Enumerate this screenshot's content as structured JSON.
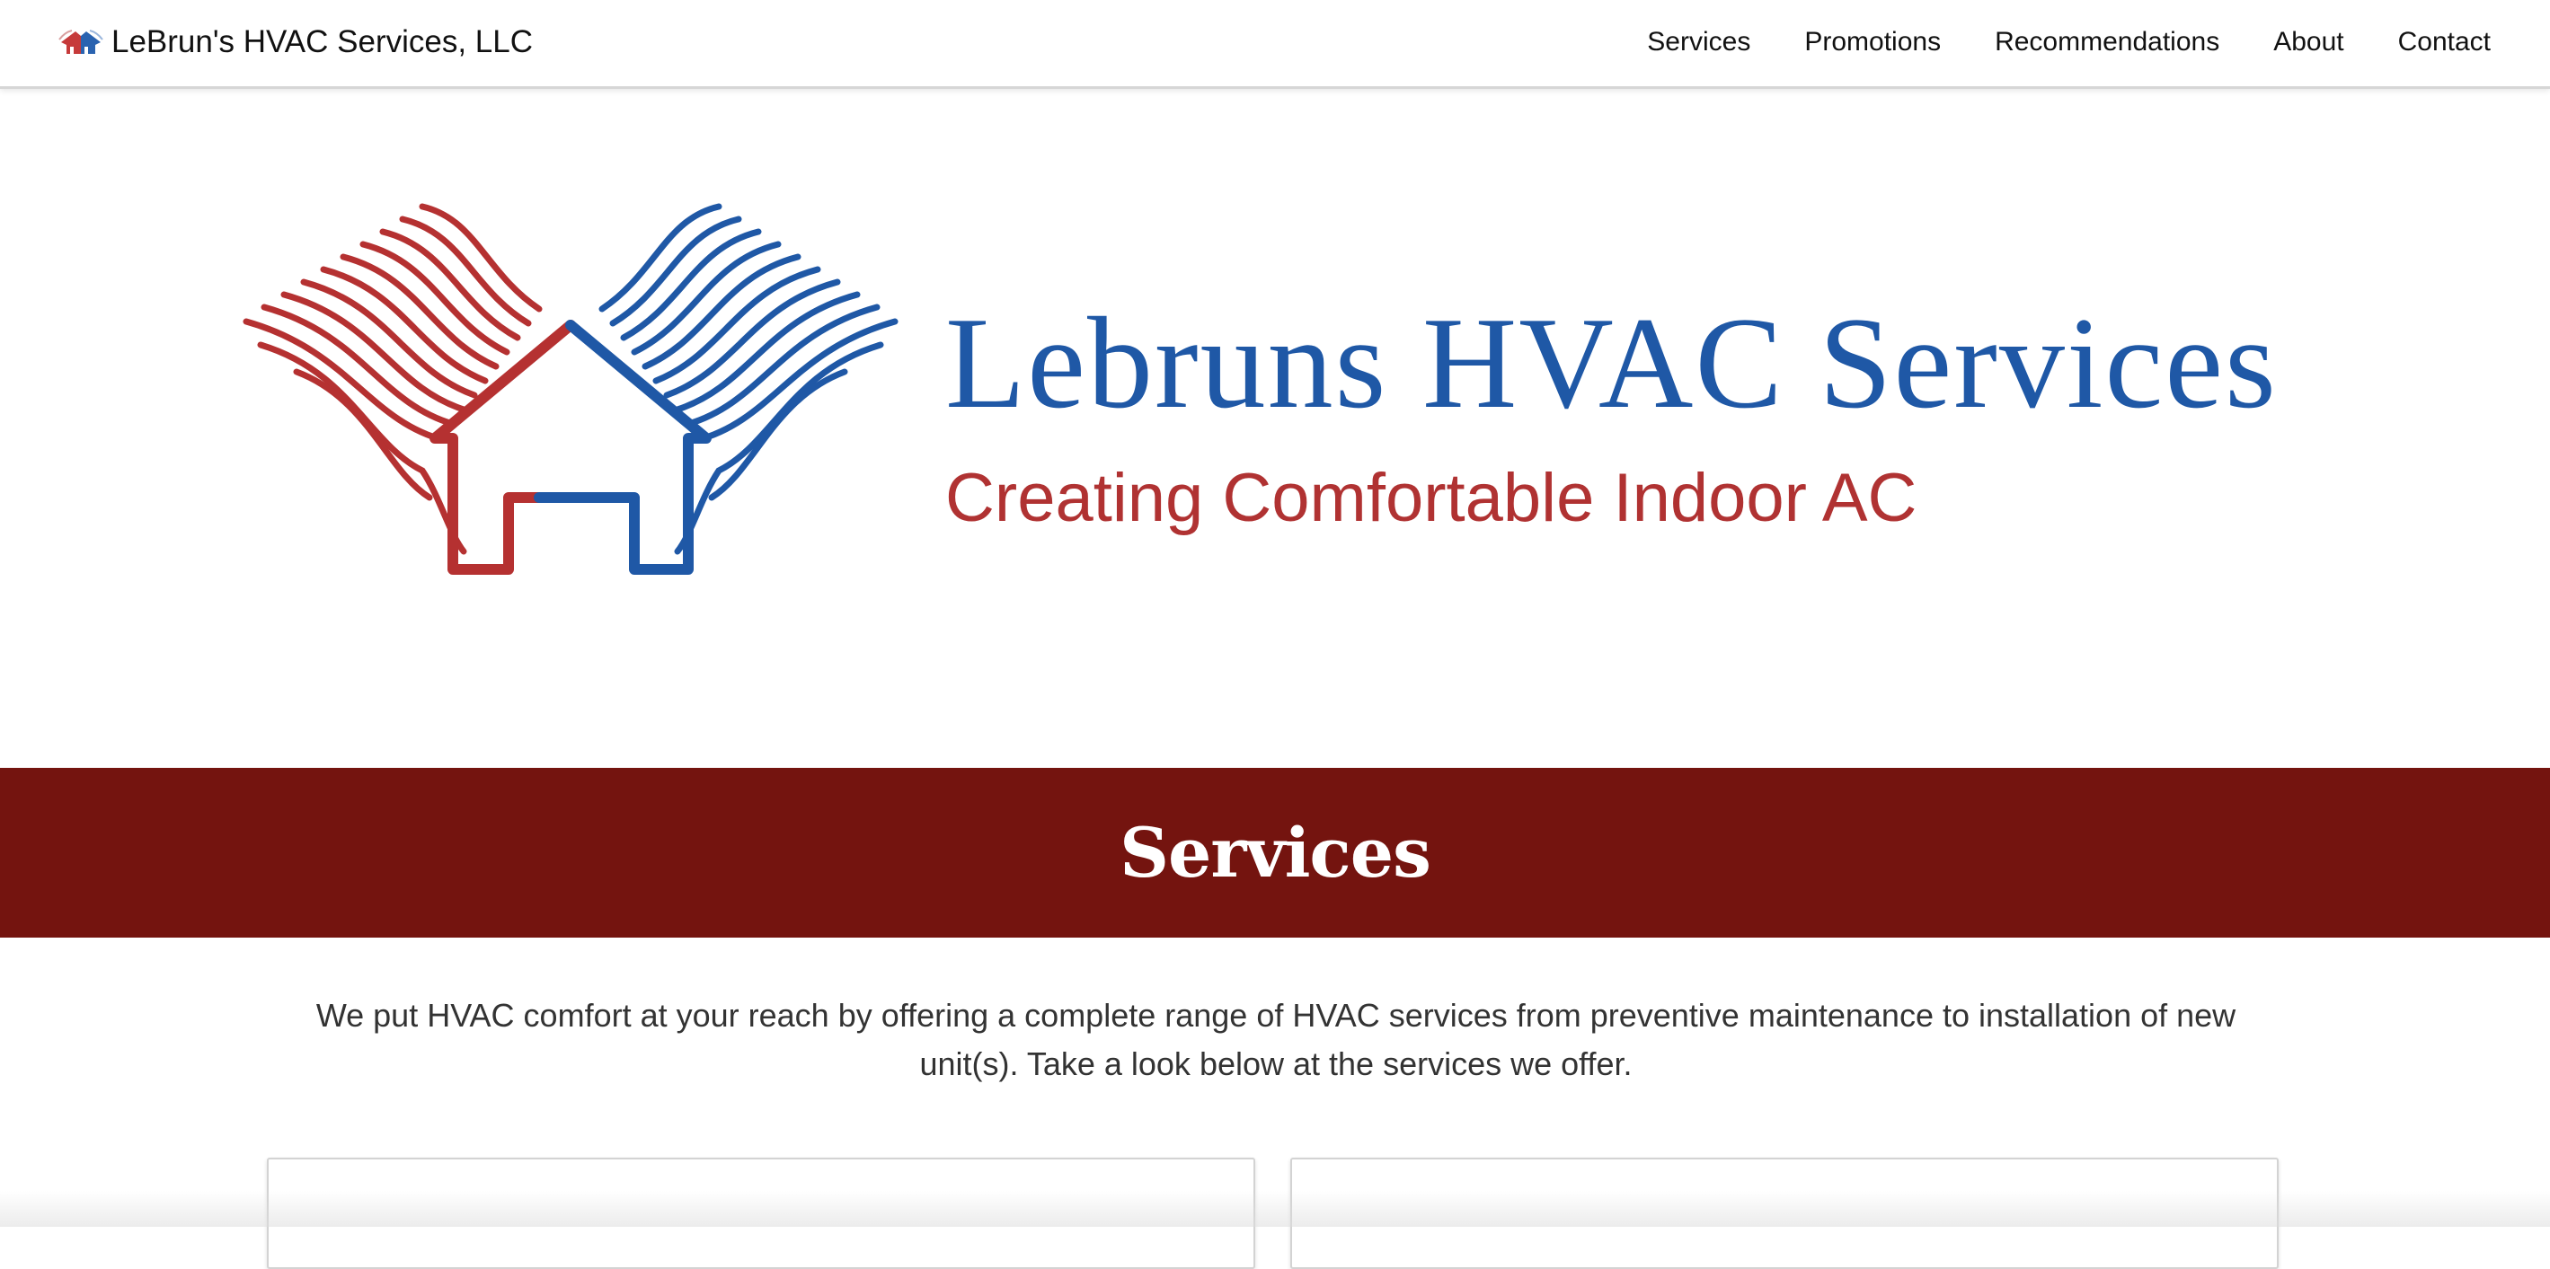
{
  "navbar": {
    "brand_text": "LeBrun's HVAC Services, LLC",
    "brand_icon": "house-logo-icon",
    "links": [
      {
        "label": "Services"
      },
      {
        "label": "Promotions"
      },
      {
        "label": "Recommendations"
      },
      {
        "label": "About"
      },
      {
        "label": "Contact"
      }
    ]
  },
  "hero": {
    "title": "Lebruns HVAC Services",
    "tagline": "Creating Comfortable Indoor AC",
    "logo_icon": "house-airflow-logo-icon"
  },
  "services": {
    "heading": "Services",
    "intro": "We put HVAC comfort at your reach by offering a complete range of HVAC services from preventive maintenance to installation of new unit(s). Take a look below at the services we offer."
  },
  "colors": {
    "brand_blue": "#1f58a6",
    "brand_red": "#b03232",
    "banner_maroon": "#74140f"
  }
}
